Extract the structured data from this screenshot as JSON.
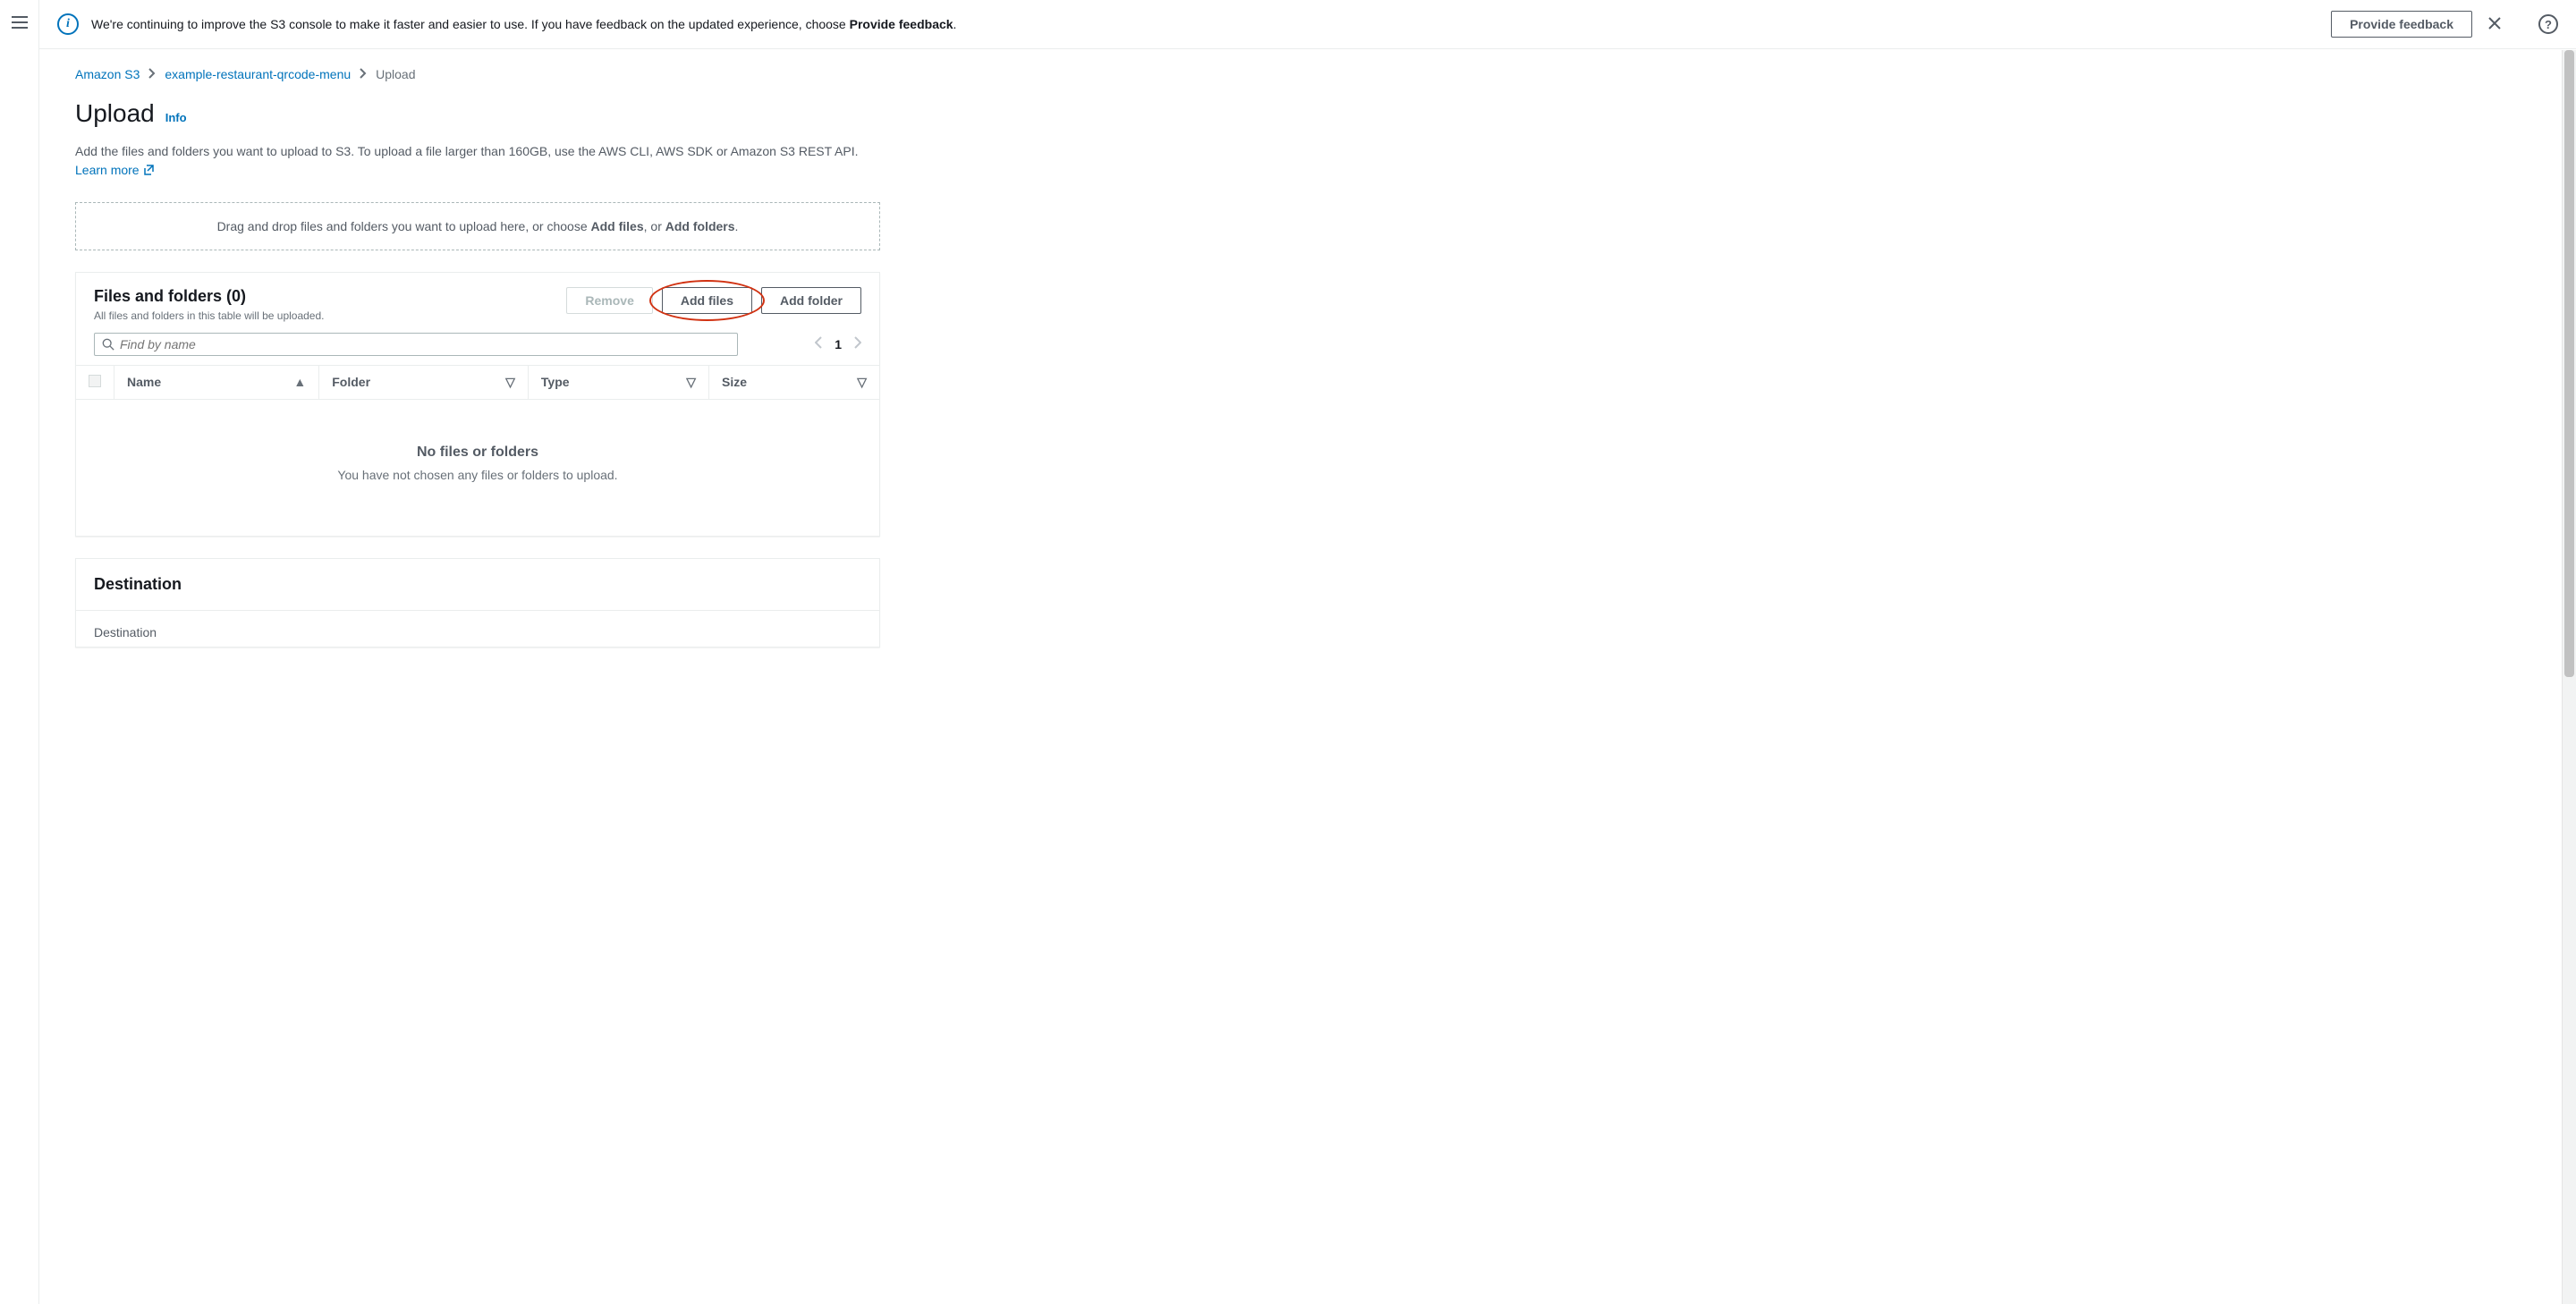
{
  "banner": {
    "text_before": "We're continuing to improve the S3 console to make it faster and easier to use. If you have feedback on the updated experience, choose ",
    "text_bold": "Provide feedback",
    "text_after": ".",
    "button": "Provide feedback"
  },
  "breadcrumb": {
    "item1": "Amazon S3",
    "item2": "example-restaurant-qrcode-menu",
    "current": "Upload"
  },
  "page": {
    "title": "Upload",
    "info": "Info",
    "description_before": "Add the files and folders you want to upload to S3. To upload a file larger than 160GB, use the AWS CLI, AWS SDK or Amazon S3 REST API. ",
    "learn_more": "Learn more"
  },
  "dropzone": {
    "before1": "Drag and drop files and folders you want to upload here, or choose ",
    "bold1": "Add files",
    "mid": ", or ",
    "bold2": "Add folders",
    "after": "."
  },
  "files_panel": {
    "title": "Files and folders (0)",
    "subtitle": "All files and folders in this table will be uploaded.",
    "remove_btn": "Remove",
    "add_files_btn": "Add files",
    "add_folder_btn": "Add folder",
    "search_placeholder": "Find by name",
    "page_number": "1",
    "columns": {
      "name": "Name",
      "folder": "Folder",
      "type": "Type",
      "size": "Size"
    },
    "empty_title": "No files or folders",
    "empty_sub": "You have not chosen any files or folders to upload."
  },
  "destination_panel": {
    "title": "Destination",
    "label": "Destination"
  }
}
